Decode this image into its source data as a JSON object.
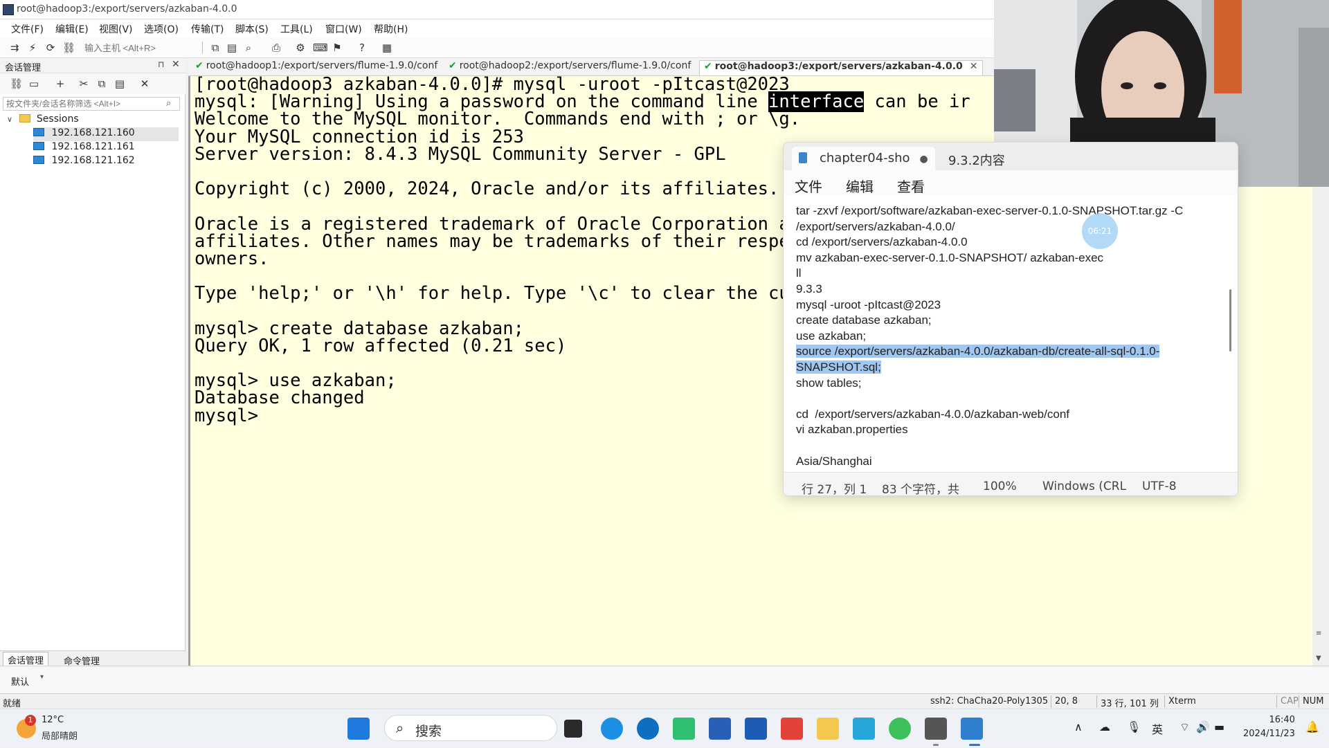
{
  "window": {
    "title": "root@hadoop3:/export/servers/azkaban-4.0.0"
  },
  "menu": [
    "文件(F)",
    "编辑(E)",
    "视图(V)",
    "选项(O)",
    "传输(T)",
    "脚本(S)",
    "工具(L)",
    "窗口(W)",
    "帮助(H)"
  ],
  "toolbar": {
    "host_placeholder": "输入主机 <Alt+R>"
  },
  "left_panel": {
    "title": "会话管理",
    "filter_placeholder": "按文件夹/会话名称筛选 <Alt+I>",
    "root": "Sessions",
    "hosts": [
      "192.168.121.160",
      "192.168.121.161",
      "192.168.121.162"
    ],
    "bottom_tabs": [
      "会话管理",
      "命令管理"
    ]
  },
  "session_tabs": [
    {
      "label": "root@hadoop1:/export/servers/flume-1.9.0/conf",
      "active": false
    },
    {
      "label": "root@hadoop2:/export/servers/flume-1.9.0/conf",
      "active": false
    },
    {
      "label": "root@hadoop3:/export/servers/azkaban-4.0.0",
      "active": true
    }
  ],
  "terminal": {
    "lines": [
      "[root@hadoop3 azkaban-4.0.0]# mysql -uroot -pItcast@2023",
      "mysql: [Warning] Using a password on the command line |interface| can be ir",
      "Welcome to the MySQL monitor.  Commands end with ; or \\g.",
      "Your MySQL connection id is 253",
      "Server version: 8.4.3 MySQL Community Server - GPL",
      "",
      "Copyright (c) 2000, 2024, Oracle and/or its affiliates.",
      "",
      "Oracle is a registered trademark of Oracle Corporation and/or its",
      "affiliates. Other names may be trademarks of their respective",
      "owners.",
      "",
      "Type 'help;' or '\\h' for help. Type '\\c' to clear the current input statement.",
      "",
      "mysql> create database azkaban;",
      "Query OK, 1 row affected (0.21 sec)",
      "",
      "mysql> use azkaban;",
      "Database changed",
      "mysql> "
    ],
    "highlight_word": "interface"
  },
  "notepad": {
    "tabs": [
      {
        "label": "chapter04-sho",
        "modified": true
      },
      {
        "label": "9.3.2内容",
        "modified": false
      }
    ],
    "menu": [
      "文件",
      "编辑",
      "查看"
    ],
    "lines": [
      "tar -zxvf /export/software/azkaban-exec-server-0.1.0-SNAPSHOT.tar.gz -C",
      "/export/servers/azkaban-4.0.0/",
      "cd /export/servers/azkaban-4.0.0",
      "mv azkaban-exec-server-0.1.0-SNAPSHOT/ azkaban-exec",
      "ll",
      "9.3.3",
      "mysql -uroot -pItcast@2023",
      "create database azkaban;",
      "use azkaban;",
      "source /export/servers/azkaban-4.0.0/azkaban-db/create-all-sql-0.1.0-",
      "SNAPSHOT.sql;",
      "show tables;",
      "",
      "cd  /export/servers/azkaban-4.0.0/azkaban-web/conf",
      "vi azkaban.properties",
      "",
      "Asia/Shanghai"
    ],
    "selected_lines": [
      9,
      10
    ],
    "status": {
      "position": "行 27，列 1",
      "count": "83 个字符，共",
      "zoom": "100%",
      "eol": "Windows (CRL",
      "encoding": "UTF-8"
    },
    "time_bubble": "06:21"
  },
  "mode_bar": {
    "label": "默认"
  },
  "statusbar": {
    "ready": "就绪",
    "cipher": "ssh2: ChaCha20-Poly1305",
    "cursor": "20,  8",
    "size": "33 行, 101 列",
    "term": "Xterm",
    "caps": "CAP",
    "num": "NUM"
  },
  "taskbar": {
    "weather_temp": "12°C",
    "weather_desc": "局部晴朗",
    "weather_badge": "1",
    "search_label": "搜索",
    "ime": "英",
    "time": "16:40",
    "date": "2024/11/23"
  },
  "colors": {
    "terminal_bg": "#ffffe0",
    "selection": "#9fc7ef",
    "tab_ok": "#1a9e33"
  }
}
